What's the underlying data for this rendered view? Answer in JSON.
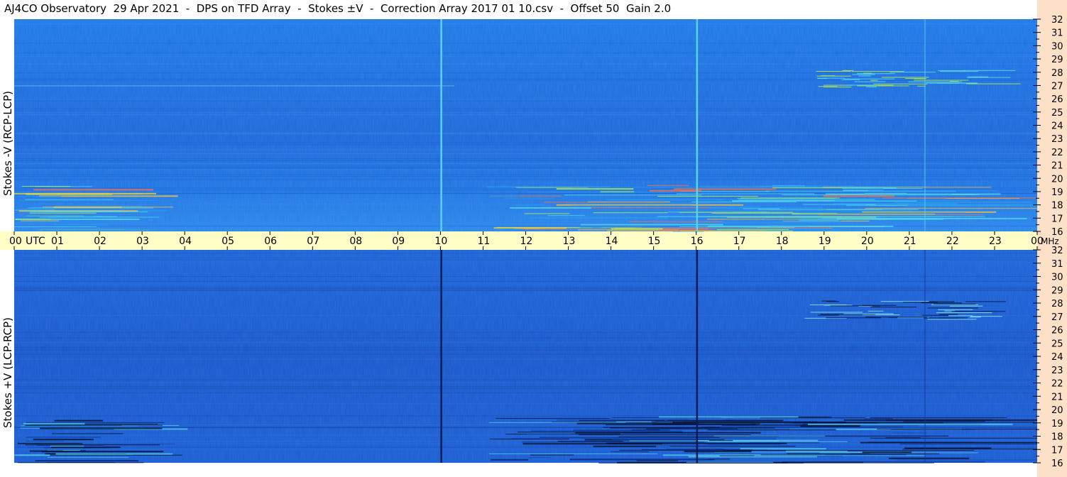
{
  "title": "AJ4CO Observatory  29 Apr 2021  -  DPS on TFD Array  -  Stokes ±V  -  Correction Array 2017 01 10.csv  -  Offset 50  Gain 2.0",
  "colors": {
    "background_top": "#1f72e4",
    "background_bottom": "#1b5ed0",
    "utc_bar": "#fefec6",
    "freq_strip": "#fde0c8"
  },
  "chart_data": [
    {
      "type": "heatmap",
      "panel": "top",
      "title": "",
      "ylabel": "Stokes -V (RCP-LCP)",
      "xlabel": "UTC",
      "x_unit": "UTC",
      "y_unit": "MHz",
      "ylim": [
        16,
        32
      ],
      "xlim": [
        0,
        24
      ],
      "x_tick_labels": [
        "00",
        "01",
        "02",
        "03",
        "04",
        "05",
        "06",
        "07",
        "08",
        "09",
        "10",
        "11",
        "12",
        "13",
        "14",
        "15",
        "16",
        "17",
        "18",
        "19",
        "20",
        "21",
        "22",
        "23",
        "00"
      ],
      "y_tick_labels": [
        "16",
        "17",
        "18",
        "19",
        "20",
        "21",
        "22",
        "23",
        "24",
        "25",
        "26",
        "27",
        "28",
        "29",
        "30",
        "31",
        "32"
      ],
      "grid": false,
      "vertical_lines_utc": [
        10.02,
        16.02
      ],
      "vertical_lines_color": "#5ad2f0"
    },
    {
      "type": "heatmap",
      "panel": "bottom",
      "title": "",
      "ylabel": "Stokes +V (LCP-RCP)",
      "xlabel": "UTC",
      "x_unit": "UTC",
      "y_unit": "MHz",
      "ylim": [
        16,
        32
      ],
      "xlim": [
        0,
        24
      ],
      "x_tick_labels": [
        "00",
        "01",
        "02",
        "03",
        "04",
        "05",
        "06",
        "07",
        "08",
        "09",
        "10",
        "11",
        "12",
        "13",
        "14",
        "15",
        "16",
        "17",
        "18",
        "19",
        "20",
        "21",
        "22",
        "23",
        "00"
      ],
      "y_tick_labels": [
        "16",
        "17",
        "18",
        "19",
        "20",
        "21",
        "22",
        "23",
        "24",
        "25",
        "26",
        "27",
        "28",
        "29",
        "30",
        "31",
        "32"
      ],
      "grid": false,
      "vertical_lines_utc": [
        10.02,
        16.02
      ],
      "vertical_lines_color": "#0a1a55"
    }
  ]
}
